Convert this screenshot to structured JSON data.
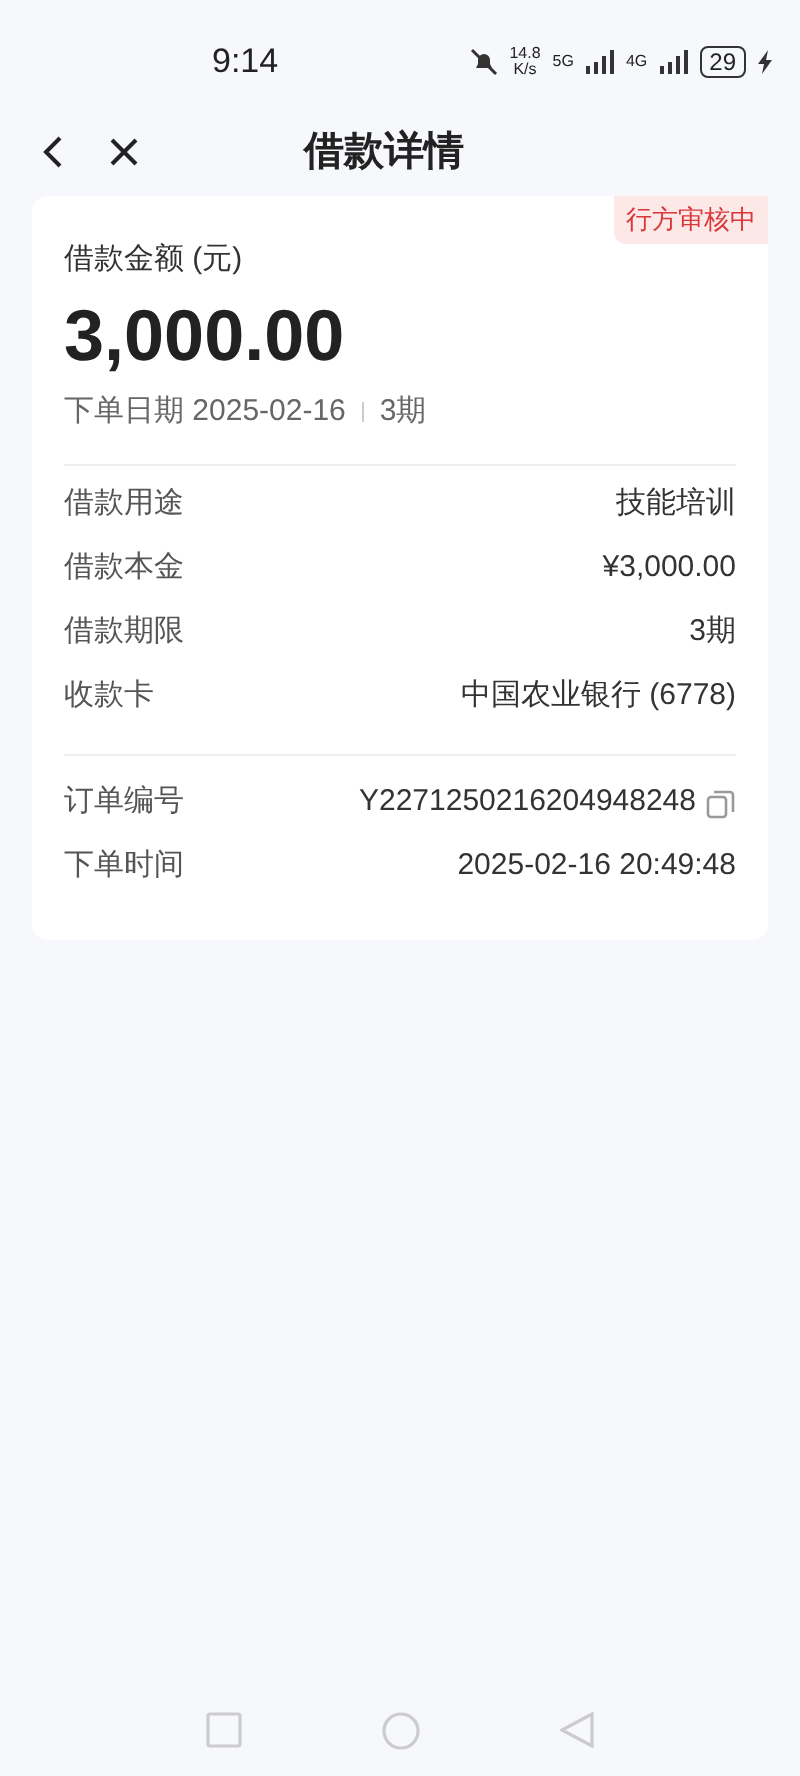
{
  "status_bar": {
    "time": "9:14",
    "speed": "14.8",
    "speed_unit": "K/s",
    "network_1": "5G",
    "network_2": "4G",
    "battery": "29"
  },
  "header": {
    "title": "借款详情"
  },
  "summary": {
    "badge": "行方审核中",
    "label": "借款金额 (元)",
    "amount": "3,000.00",
    "date": "下单日期 2025-02-16",
    "term": "3期"
  },
  "details": [
    {
      "label": "借款用途",
      "value": "技能培训"
    },
    {
      "label": "借款本金",
      "value": "¥3,000.00"
    },
    {
      "label": "借款期限",
      "value": "3期"
    },
    {
      "label": "收款卡",
      "value": "中国农业银行 (6778)"
    }
  ],
  "order": [
    {
      "label": "订单编号",
      "value": "Y2271250216204948248",
      "kind": "copyable"
    },
    {
      "label": "下单时间",
      "value": "2025-02-16 20:49:48",
      "kind": "plain"
    }
  ]
}
